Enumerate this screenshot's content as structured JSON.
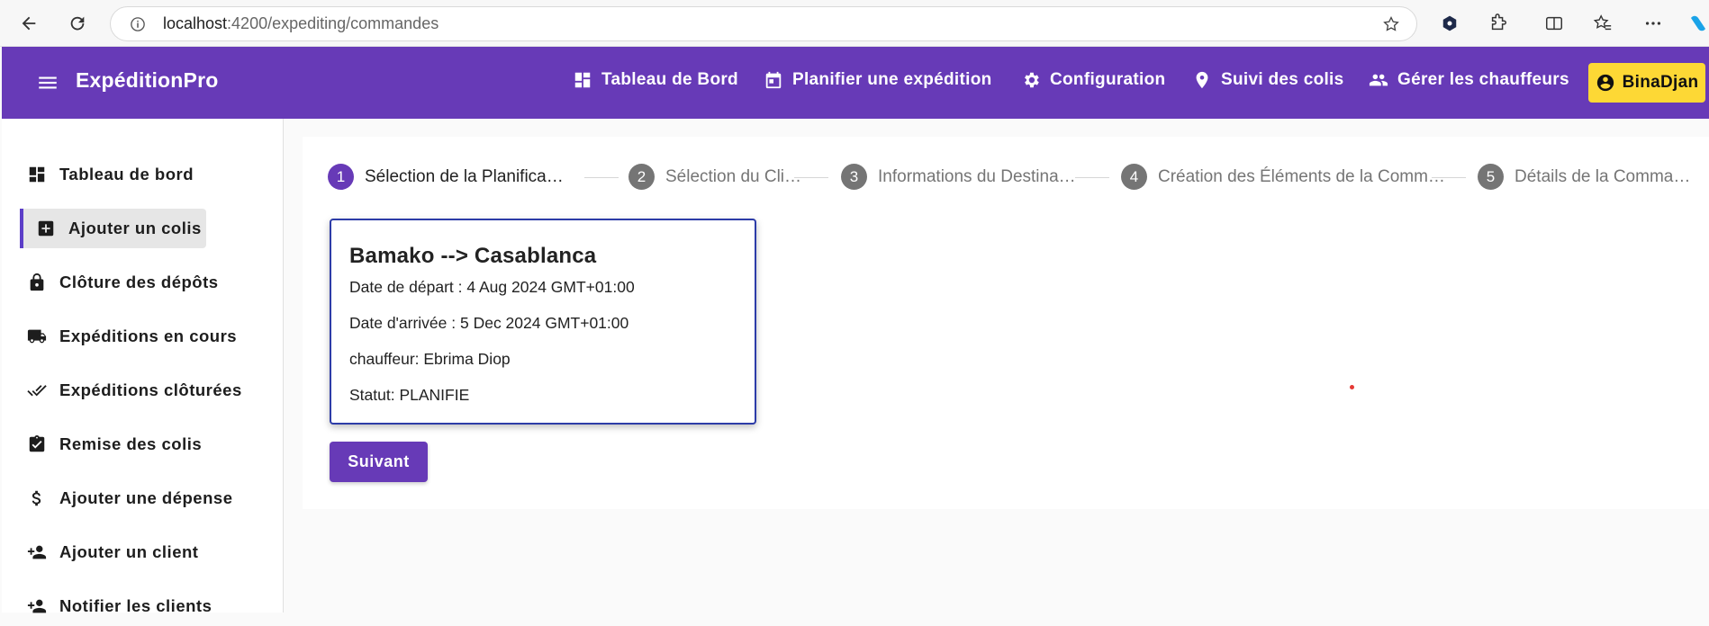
{
  "browser": {
    "url_host": "localhost",
    "url_rest": ":4200/expediting/commandes"
  },
  "header": {
    "brand": "ExpéditionPro",
    "nav": [
      {
        "label": "Tableau de Bord",
        "icon": "dashboard-icon"
      },
      {
        "label": "Planifier une expédition",
        "icon": "calendar-icon"
      },
      {
        "label": "Configuration",
        "icon": "gear-icon"
      },
      {
        "label": "Suivi des colis",
        "icon": "location-pin-icon"
      },
      {
        "label": "Gérer les chauffeurs",
        "icon": "people-icon"
      }
    ],
    "user": "BinaDjan",
    "accent": "#673ab7",
    "user_color": "#fdd835"
  },
  "sidebar": {
    "items": [
      {
        "label": "Tableau de bord",
        "icon": "dashboard-icon"
      },
      {
        "label": "Ajouter un colis",
        "icon": "add-box-icon"
      },
      {
        "label": "Clôture des dépôts",
        "icon": "lock-icon"
      },
      {
        "label": "Expéditions en cours",
        "icon": "truck-icon"
      },
      {
        "label": "Expéditions clôturées",
        "icon": "double-check-icon"
      },
      {
        "label": "Remise des colis",
        "icon": "clipboard-check-icon"
      },
      {
        "label": "Ajouter une dépense",
        "icon": "dollar-icon"
      },
      {
        "label": "Ajouter un client",
        "icon": "person-add-icon"
      },
      {
        "label": "Notifier les clients",
        "icon": "person-add-icon"
      }
    ],
    "active_index": 1
  },
  "stepper": {
    "steps": [
      {
        "num": "1",
        "label": "Sélection de la Planifica…"
      },
      {
        "num": "2",
        "label": "Sélection du Cli…"
      },
      {
        "num": "3",
        "label": "Informations du Destina…"
      },
      {
        "num": "4",
        "label": "Création des Éléments de la Comm…"
      },
      {
        "num": "5",
        "label": "Détails de la Comma…"
      }
    ],
    "active_index": 0
  },
  "trip": {
    "title": "Bamako --> Casablanca",
    "departure": "Date de départ : 4 Aug 2024 GMT+01:00",
    "arrival": "Date d'arrivée : 5 Dec 2024 GMT+01:00",
    "driver": "chauffeur: Ebrima Diop",
    "status": "Statut: PLANIFIE"
  },
  "next_label": "Suivant"
}
